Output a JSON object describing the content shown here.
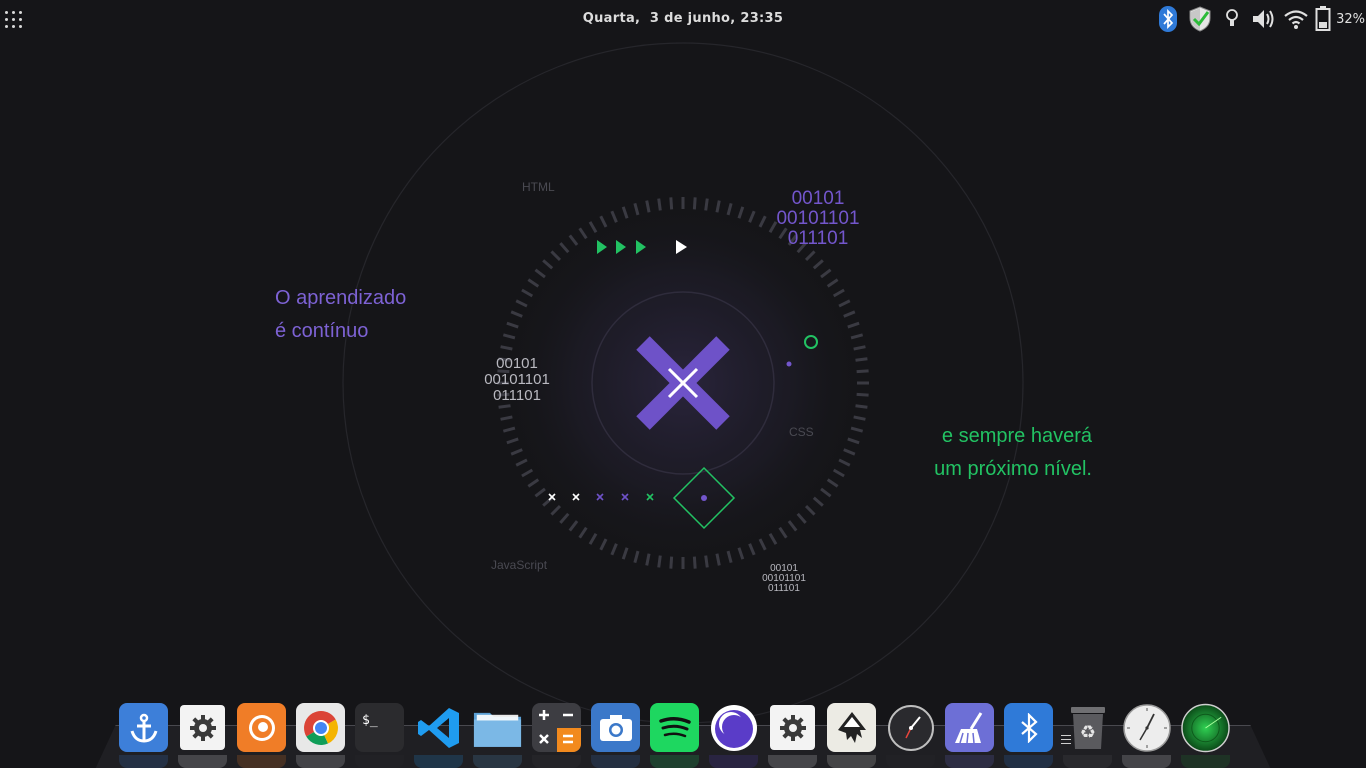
{
  "top_panel": {
    "clock": "Quarta,  3 de junho, 23:35",
    "tray": {
      "battery_percent": "32%",
      "icons": [
        "bluetooth-icon",
        "shield-check-icon",
        "lightbulb-icon",
        "volume-icon",
        "wifi-icon",
        "battery-icon"
      ]
    }
  },
  "wallpaper": {
    "message_left": [
      "O aprendizado",
      "é contínuo"
    ],
    "message_right": [
      "e sempre haverá",
      "um próximo nível."
    ],
    "binary": [
      "00101",
      "00101101",
      "011101"
    ],
    "tags": [
      "HTML",
      "CSS",
      "JavaScript"
    ],
    "colors": {
      "purple": "#7d62d4",
      "green": "#22c263",
      "background": "#151518"
    }
  },
  "dock": {
    "items": [
      "anchor-icon",
      "settings-gear-icon",
      "firefox-icon",
      "chrome-icon",
      "terminal-icon",
      "vscode-icon",
      "folder-icon",
      "calculator-icon",
      "screenshot-camera-icon",
      "spotify-icon",
      "eclipse-moon-icon",
      "system-settings-icon",
      "inkscape-icon",
      "clock-app-icon",
      "cleaner-broom-icon",
      "bluetooth-app-icon",
      "trash-icon",
      "analog-clock-icon",
      "radar-icon"
    ]
  }
}
